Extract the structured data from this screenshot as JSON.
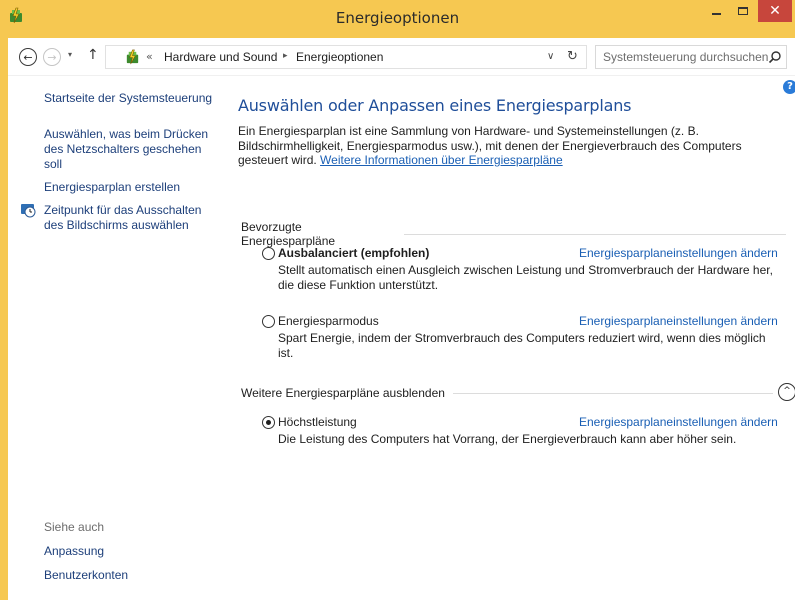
{
  "window": {
    "title": "Energieoptionen",
    "close_symbol": "✕"
  },
  "nav": {
    "back_symbol": "←",
    "forward_symbol": "→",
    "recent_symbol": "▾",
    "up_symbol": "↑",
    "address_chevron": "«",
    "breadcrumb": [
      "Hardware und Sound",
      "Energieoptionen"
    ],
    "breadcrumb_sep": "▸",
    "dropdown_symbol": "∨",
    "refresh_symbol": "↻",
    "search_placeholder": "Systemsteuerung durchsuchen"
  },
  "help_symbol": "?",
  "sidebar": {
    "home": "Startseite der Systemsteuerung",
    "power_button": "Auswählen, was beim Drücken des Netzschalters geschehen soll",
    "create_plan": "Energiesparplan erstellen",
    "display_off": "Zeitpunkt für das Ausschalten des Bildschirms auswählen",
    "see_also": "Siehe auch",
    "personalization": "Anpassung",
    "user_accounts": "Benutzerkonten"
  },
  "main": {
    "title": "Auswählen oder Anpassen eines Energiesparplans",
    "intro": "Ein Energiesparplan ist eine Sammlung von Hardware- und Systemeinstellungen (z. B. Bildschirmhelligkeit, Energiesparmodus usw.), mit denen der Energieverbrauch des Computers gesteuert wird. ",
    "intro_link": "Weitere Informationen über Energiesparpläne",
    "preferred_header": "Bevorzugte Energiesparpläne",
    "more_header": "Weitere Energiesparpläne ausblenden",
    "collapse_symbol": "^",
    "change_link": "Energiesparplaneinstellungen ändern",
    "plans": [
      {
        "name": "Ausbalanciert (empfohlen)",
        "description": "Stellt automatisch einen Ausgleich zwischen Leistung und Stromverbrauch der Hardware her, die diese Funktion unterstützt.",
        "selected": false
      },
      {
        "name": "Energiesparmodus",
        "description": "Spart Energie, indem der Stromverbrauch des Computers reduziert wird, wenn dies möglich ist.",
        "selected": false
      },
      {
        "name": "Höchstleistung",
        "description": "Die Leistung des Computers hat Vorrang, der Energieverbrauch kann aber höher sein.",
        "selected": true
      }
    ]
  },
  "colors": {
    "frame": "#f6c851",
    "close": "#c7463c",
    "link": "#1a5fb4",
    "heading": "#1f4e99"
  }
}
